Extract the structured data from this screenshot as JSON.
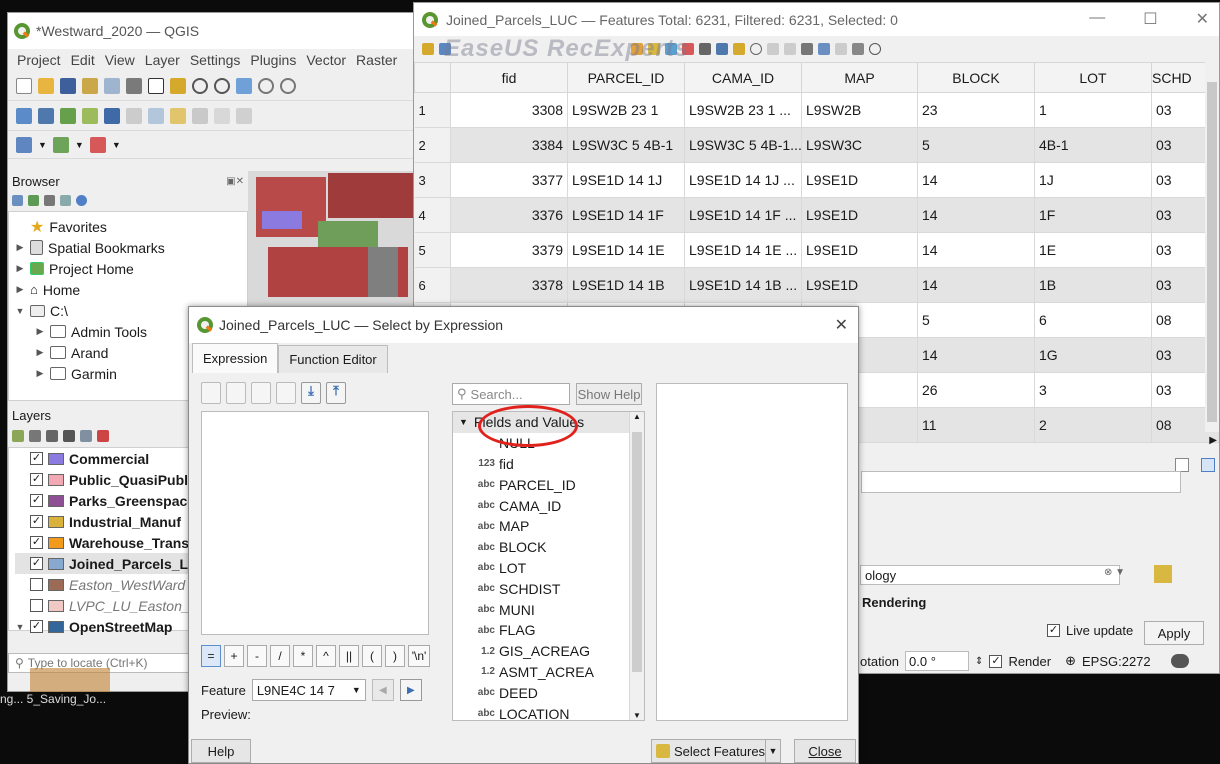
{
  "main": {
    "title": "*Westward_2020 — QGIS",
    "menu": [
      "Project",
      "Edit",
      "View",
      "Layer",
      "Settings",
      "Plugins",
      "Vector",
      "Raster"
    ],
    "browser": {
      "header": "Browser",
      "items": [
        {
          "label": "Favorites",
          "icon": "star-icon"
        },
        {
          "label": "Spatial Bookmarks",
          "icon": "bookmark-icon"
        },
        {
          "label": "Project Home",
          "icon": "project-home-icon"
        },
        {
          "label": "Home",
          "icon": "home-icon"
        },
        {
          "label": "C:\\",
          "icon": "drive-icon"
        },
        {
          "label": "Admin Tools",
          "icon": "folder-icon"
        },
        {
          "label": "Arand",
          "icon": "folder-icon"
        },
        {
          "label": "Garmin",
          "icon": "folder-icon"
        }
      ]
    },
    "layers": {
      "header": "Layers",
      "items": [
        {
          "label": "Commercial",
          "color": "#8b7be0",
          "checked": true,
          "bold": true
        },
        {
          "label": "Public_QuasiPubl",
          "color": "#f2a9b3",
          "checked": true,
          "bold": true
        },
        {
          "label": "Parks_Greenspace",
          "color": "#8e4f94",
          "checked": true,
          "bold": true
        },
        {
          "label": "Industrial_Manuf",
          "color": "#d8b23a",
          "checked": true,
          "bold": true
        },
        {
          "label": "Warehouse_Trans",
          "color": "#f29a1c",
          "checked": true,
          "bold": true
        },
        {
          "label": "Joined_Parcels_LU",
          "color": "#87a9cf",
          "checked": true,
          "bold": true
        },
        {
          "label": "Easton_WestWard",
          "color": "#9c6b55",
          "checked": false,
          "bold": false
        },
        {
          "label": "LVPC_LU_Easton_",
          "color": "#f0c8c4",
          "checked": false,
          "bold": false
        },
        {
          "label": "OpenStreetMap",
          "color": "#336699",
          "checked": true,
          "bold": true
        }
      ]
    },
    "locate_placeholder": "Type to locate (Ctrl+K)",
    "taskbar": "ng... 5_Saving_Jo..."
  },
  "attr": {
    "title": "Joined_Parcels_LUC — Features Total: 6231, Filtered: 6231, Selected: 0",
    "watermark": "EaseUS RecExperts",
    "columns": [
      "fid",
      "PARCEL_ID",
      "CAMA_ID",
      "MAP",
      "BLOCK",
      "LOT",
      "SCHD"
    ],
    "rows": [
      {
        "n": "1",
        "fid": "3308",
        "parcel": "L9SW2B 23 1",
        "cama": "L9SW2B 23 1     ...",
        "map": "L9SW2B",
        "block": "23",
        "lot": "1",
        "schd": "03"
      },
      {
        "n": "2",
        "fid": "3384",
        "parcel": "L9SW3C 5  4B-1",
        "cama": "L9SW3C 5  4B-1...",
        "map": "L9SW3C",
        "block": "5",
        "lot": "4B-1",
        "schd": "03"
      },
      {
        "n": "3",
        "fid": "3377",
        "parcel": "L9SE1D 14 1J",
        "cama": "L9SE1D 14 1J    ...",
        "map": "L9SE1D",
        "block": "14",
        "lot": "1J",
        "schd": "03"
      },
      {
        "n": "4",
        "fid": "3376",
        "parcel": "L9SE1D 14 1F",
        "cama": "L9SE1D 14 1F    ...",
        "map": "L9SE1D",
        "block": "14",
        "lot": "1F",
        "schd": "03"
      },
      {
        "n": "5",
        "fid": "3379",
        "parcel": "L9SE1D 14 1E",
        "cama": "L9SE1D 14 1E    ...",
        "map": "L9SE1D",
        "block": "14",
        "lot": "1E",
        "schd": "03"
      },
      {
        "n": "6",
        "fid": "3378",
        "parcel": "L9SE1D 14 1B",
        "cama": "L9SE1D 14 1B    ...",
        "map": "L9SE1D",
        "block": "14",
        "lot": "1B",
        "schd": "03"
      },
      {
        "n": "",
        "fid": "",
        "parcel": "",
        "cama": "",
        "map": "",
        "block": "5",
        "lot": "6",
        "schd": "08"
      },
      {
        "n": "",
        "fid": "",
        "parcel": "",
        "cama": "",
        "map": "",
        "block": "14",
        "lot": "1G",
        "schd": "03"
      },
      {
        "n": "",
        "fid": "",
        "parcel": "",
        "cama": "",
        "map": "",
        "block": "26",
        "lot": "3",
        "schd": "03"
      },
      {
        "n": "",
        "fid": "",
        "parcel": "",
        "cama": "",
        "map": "",
        "block": "11",
        "lot": "2",
        "schd": "08"
      }
    ],
    "side": {
      "symbology": "ology",
      "rendering": "Rendering",
      "live_update": "Live update",
      "apply": "Apply"
    },
    "status": {
      "rotation_label": "otation",
      "rotation_value": "0.0 °",
      "render": "Render",
      "epsg": "EPSG:2272"
    }
  },
  "dialog": {
    "title": "Joined_Parcels_LUC — Select by Expression",
    "tabs": [
      "Expression",
      "Function Editor"
    ],
    "search_placeholder": "Search...",
    "show_help": "Show Help",
    "tree_root": "Fields and Values",
    "fields": [
      {
        "t": "",
        "n": "NULL"
      },
      {
        "t": "123",
        "n": "fid"
      },
      {
        "t": "abc",
        "n": "PARCEL_ID"
      },
      {
        "t": "abc",
        "n": "CAMA_ID"
      },
      {
        "t": "abc",
        "n": "MAP"
      },
      {
        "t": "abc",
        "n": "BLOCK"
      },
      {
        "t": "abc",
        "n": "LOT"
      },
      {
        "t": "abc",
        "n": "SCHDIST"
      },
      {
        "t": "abc",
        "n": "MUNI"
      },
      {
        "t": "abc",
        "n": "FLAG"
      },
      {
        "t": "1.2",
        "n": "GIS_ACREAG"
      },
      {
        "t": "1.2",
        "n": "ASMT_ACREA"
      },
      {
        "t": "abc",
        "n": "DEED"
      },
      {
        "t": "abc",
        "n": "LOCATION"
      }
    ],
    "operators": [
      "=",
      "+",
      "-",
      "/",
      "*",
      "^",
      "||",
      "(",
      ")",
      "'\\n'"
    ],
    "feature_label": "Feature",
    "feature_value": "L9NE4C 14 7",
    "preview_label": "Preview:",
    "help": "Help",
    "select_features": "Select Features",
    "close": "Close"
  }
}
